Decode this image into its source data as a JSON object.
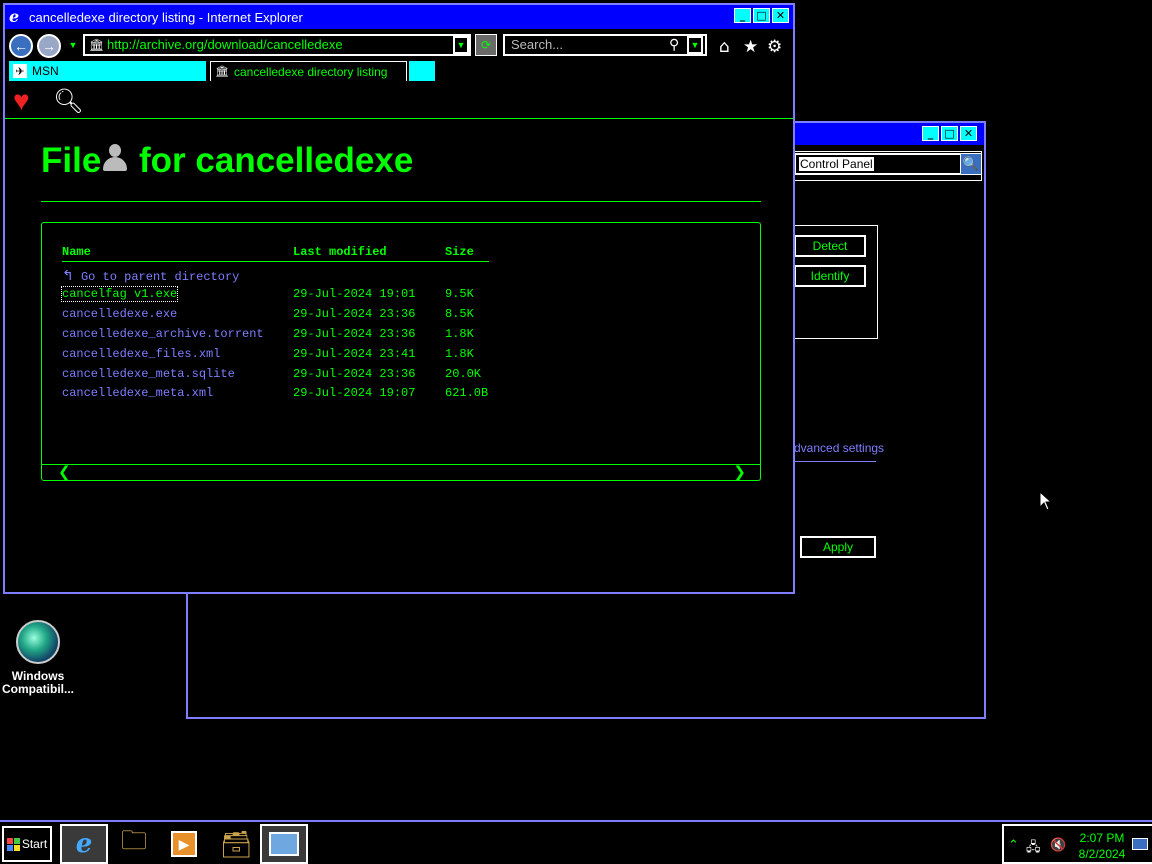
{
  "control_panel": {
    "address": "Control Panel",
    "buttons": {
      "detect": "Detect",
      "identify": "Identify",
      "apply": "Apply"
    },
    "advanced_link": "dvanced settings"
  },
  "ie": {
    "title": "cancelledexe directory listing - Internet Explorer",
    "address": "http://archive.org/download/cancelledexe",
    "search_placeholder": "Search...",
    "tabs": [
      {
        "label": "MSN"
      },
      {
        "label": "cancelledexe directory listing"
      }
    ],
    "page": {
      "heading_prefix": "File",
      "heading_suffix": " for cancelledexe",
      "columns": {
        "name": "Name",
        "modified": "Last modified",
        "size": "Size"
      },
      "parent": "Go to parent directory",
      "files": [
        {
          "name": "cancelfag v1.exe",
          "modified": "29-Jul-2024 19:01",
          "size": "9.5K"
        },
        {
          "name": "cancelledexe.exe",
          "modified": "29-Jul-2024 23:36",
          "size": "8.5K"
        },
        {
          "name": "cancelledexe_archive.torrent",
          "modified": "29-Jul-2024 23:36",
          "size": "1.8K"
        },
        {
          "name": "cancelledexe_files.xml",
          "modified": "29-Jul-2024 23:41",
          "size": "1.8K"
        },
        {
          "name": "cancelledexe_meta.sqlite",
          "modified": "29-Jul-2024 23:36",
          "size": "20.0K"
        },
        {
          "name": "cancelledexe_meta.xml",
          "modified": "29-Jul-2024 19:07",
          "size": "621.0B"
        }
      ]
    }
  },
  "desktop": {
    "icon_label_1": "Windows",
    "icon_label_2": "Compatibil..."
  },
  "taskbar": {
    "start": "Start",
    "time": "2:07 PM",
    "date": "8/2/2024"
  },
  "colors": {
    "accent": "#00ff00",
    "link": "#7e7eff",
    "titlebar": "#0000ff",
    "border": "#7e7eff"
  }
}
